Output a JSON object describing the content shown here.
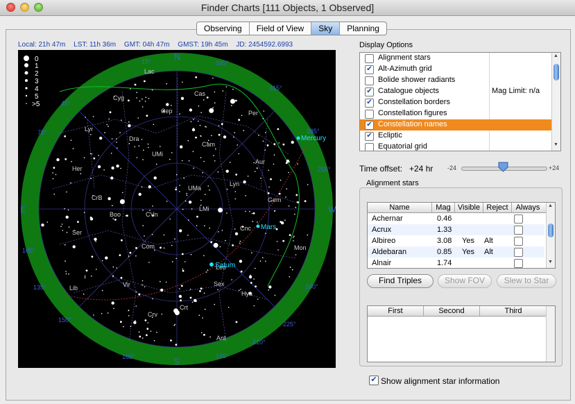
{
  "window": {
    "title": "Finder Charts [111 Objects, 1 Observed]"
  },
  "tabs": [
    {
      "label": "Observing",
      "selected": false
    },
    {
      "label": "Field of View",
      "selected": false
    },
    {
      "label": "Sky",
      "selected": true
    },
    {
      "label": "Planning",
      "selected": false
    }
  ],
  "info": {
    "local": "Local: 21h 47m",
    "lst": "LST: 11h 36m",
    "gmt": "GMT: 04h 47m",
    "gmst": "GMST: 19h 45m",
    "jd": "JD: 2454592.6993"
  },
  "legend": {
    "items": [
      "0",
      "1",
      "2",
      "3",
      "4",
      "5",
      ">5"
    ]
  },
  "sky": {
    "cardinals": [
      "N",
      "E",
      "S",
      "W"
    ],
    "azimuth_labels": [
      "15°",
      "345°",
      "315°",
      "285°",
      "255°",
      "225°",
      "195°",
      "165°",
      "135°",
      "105°",
      "75°",
      "45°",
      "210°",
      "150°",
      "240°"
    ],
    "constellations": [
      "Lac",
      "Cyg",
      "Cas",
      "Cep",
      "Per",
      "Dra",
      "Lyr",
      "UMi",
      "Cam",
      "Aur",
      "Her",
      "UMa",
      "Lyn",
      "CrB",
      "Boo",
      "Gem",
      "CVn",
      "LMi",
      "Cnc",
      "Ser",
      "Com",
      "Mon",
      "Leo",
      "Vir",
      "Sex",
      "Lib",
      "Crt",
      "Hya",
      "Crv",
      "Ant"
    ],
    "planets": [
      "Mercury",
      "Mars",
      "Saturn"
    ],
    "colors": {
      "horizon": "#0f7a12",
      "planet": "#20e0ff",
      "grid": "#3a3a8a"
    }
  },
  "display_options": {
    "title": "Display Options",
    "items": [
      {
        "label": "Alignment stars",
        "checked": false,
        "extra": ""
      },
      {
        "label": "Alt-Azimuth grid",
        "checked": true,
        "extra": ""
      },
      {
        "label": "Bolide shower radiants",
        "checked": false,
        "extra": ""
      },
      {
        "label": "Catalogue objects",
        "checked": true,
        "extra": "Mag Limit: n/a"
      },
      {
        "label": "Constellation borders",
        "checked": true,
        "extra": ""
      },
      {
        "label": "Constellation figures",
        "checked": false,
        "extra": ""
      },
      {
        "label": "Constellation names",
        "checked": true,
        "extra": "",
        "selected": true
      },
      {
        "label": "Ecliptic",
        "checked": true,
        "extra": ""
      },
      {
        "label": "Equatorial grid",
        "checked": false,
        "extra": ""
      }
    ]
  },
  "time_offset": {
    "label": "Time offset:",
    "value": "+24 hr",
    "min": "-24",
    "max": "+24",
    "position": 0.5
  },
  "alignment_stars": {
    "title": "Alignment stars",
    "columns": [
      "Name",
      "Mag",
      "Visible",
      "Reject",
      "Always"
    ],
    "rows": [
      {
        "name": "Achernar",
        "mag": "0.46",
        "visible": "",
        "reject": ""
      },
      {
        "name": "Acrux",
        "mag": "1.33",
        "visible": "",
        "reject": ""
      },
      {
        "name": "Albireo",
        "mag": "3.08",
        "visible": "Yes",
        "reject": "Alt"
      },
      {
        "name": "Aldebaran",
        "mag": "0.85",
        "visible": "Yes",
        "reject": "Alt"
      },
      {
        "name": "Alnair",
        "mag": "1.74",
        "visible": "",
        "reject": ""
      }
    ],
    "buttons": {
      "find_triples": "Find Triples",
      "show_fov": "Show FOV",
      "slew_to_star": "Slew to Star"
    },
    "triples_columns": [
      "First",
      "Second",
      "Third"
    ]
  },
  "show_info": {
    "label": "Show alignment star information",
    "checked": true
  }
}
